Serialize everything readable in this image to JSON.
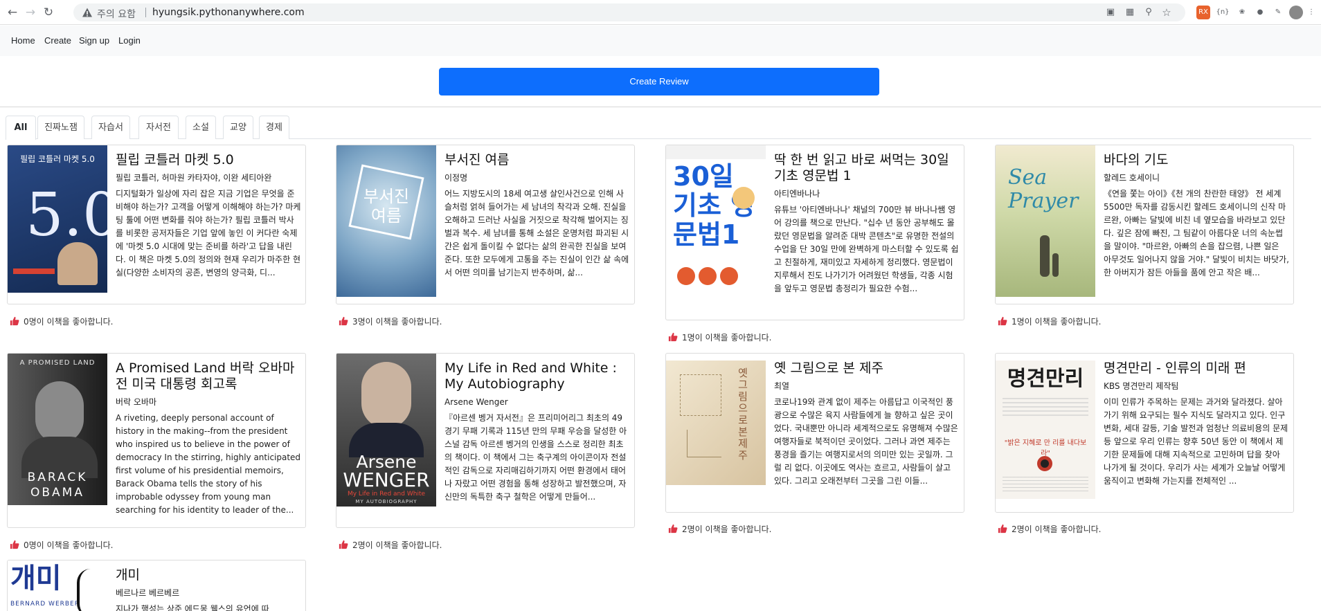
{
  "browser": {
    "warning": "주의 요함",
    "url": "hyungsik.pythonanywhere.com"
  },
  "nav": {
    "links": [
      "Home",
      "Create",
      "Sign up",
      "Login"
    ]
  },
  "create_button": "Create Review",
  "tabs": [
    "All",
    "진짜노잼",
    "자습서",
    "자서전",
    "소설",
    "교양",
    "경제"
  ],
  "books": [
    {
      "title": "필립 코틀러 마켓 5.0",
      "author": "필립 코틀러, 허마원 카타자야, 이완 세티아완",
      "desc": "디지털화가 일상에 자리 잡은 지금 기업은 무엇을 준비해야 하는가? 고객을 어떻게 이해해야 하는가? 마케팅 툴에 어떤 변화를 줘야 하는가? 필립 코틀러 박사를 비롯한 공저자들은 기업 앞에 놓인 이 커다란 숙제에 '마켓 5.0 시대에 맞는 준비를 하라'고 답을 내린다. 이 책은 마켓 5.0의 정의와 현재 우리가 마주한 현실(다양한 소비자의 공존, 변영의 양극화, 디...",
      "likes": "0명이 이책을 좋아합니다.",
      "cover_text": "필립 코틀러 마켓 5.0"
    },
    {
      "title": "부서진 여름",
      "author": "이정명",
      "desc": "어느 지방도시의 18세 여고생 살인사건으로 인해 사슬처럼 얽혀 들어가는 세 남녀의 착각과 오해. 진실을 오해하고 드러난 사실을 거짓으로 착각해 벌어지는 징벌과 복수. 세 남녀를 통해 소설은 운명처럼 파괴된 시간은 쉽게 돌이킬 수 없다는 삶의 완곡한 진실을 보여준다. 또한 모두에게 고통을 주는 진실이 인간 삶 속에서 어떤 의미를 남기는지 반추하며, 삶...",
      "likes": "3명이 이책을 좋아합니다.",
      "cover_text": "부서진 여름"
    },
    {
      "title": "딱 한 번 읽고 바로 써먹는 30일 기초 영문법 1",
      "author": "아티엔바나나",
      "desc": "유튜브 '아티엔바나나' 채널의 700만 뷰 바나나쌤 영어 강의를 책으로 만난다. \"십수 년 동안 공부해도 몰랐던 영문법을 알려준 대박 콘텐츠\"로 유명한 전설의 수업을 단 30일 만에 완벽하게 마스터할 수 있도록 쉽고 친절하게, 재미있고 자세하게 정리했다. 영문법이 지루해서 진도 나가기가 어려웠던 학생들, 각종 시험을 앞두고 영문법 총정리가 필요한 수험...",
      "likes": "1명이 이책을 좋아합니다.",
      "cover_text": "30일 기초 영문법1"
    },
    {
      "title": "바다의 기도",
      "author": "할레드 호세이니",
      "desc": "《연을 쫓는 아이》《천 개의 찬란한 태양》 전 세계 5500만 독자를 감동시킨 할레드 호세이니의 신작 마르완, 아빠는 달빛에 비친 네 옆모습을 바라보고 있단다. 깊은 잠에 빠진, 그 팀같이 아름다운 너의 속눈썹을 말이야. \"마르완, 아빠의 손을 잡으렴, 나쁜 일은 아무것도 일어나지 않을 거야.\" 달빛이 비치는 바닷가, 한 아버지가 잠든 아들을 품에 안고 작은 배...",
      "likes": "1명이 이책을 좋아합니다.",
      "cover_text": "Sea Prayer"
    },
    {
      "title": "A Promised Land 버락 오바마 전 미국 대통령 회고록",
      "author": "버락 오바마",
      "desc": "A riveting, deeply personal account of history in the making--from the president who inspired us to believe in the power of democracy In the stirring, highly anticipated first volume of his presidential memoirs, Barack Obama tells the story of his improbable odyssey from young man searching for his identity to leader of the...",
      "likes": "0명이 이책을 좋아합니다.",
      "cover_top": "A PROMISED LAND",
      "cover_name": "BARACK OBAMA"
    },
    {
      "title": "My Life in Red and White : My Autobiography",
      "author": "Arsene Wenger",
      "desc": "『아르센 벵거 자서전』은 프리미어리그 최초의 49경기 무패 기록과 115년 만의 무패 우승을 달성한 아스널 감독 아르센 벵거의 인생을 스스로 정리한 최초의 책이다. 이 책에서 그는 축구계의 아이콘이자 전설적인 감독으로 자리매김하기까지 어떤 환경에서 태어나 자랐고 어떤 경험을 통해 성장하고 발전했으며, 자신만의 독특한 축구 철학은 어떻게 만들어...",
      "likes": "2명이 이책을 좋아합니다.",
      "cover_name1": "Arsene",
      "cover_name2": "WENGER",
      "cover_sub": "My Life in Red and White",
      "cover_bottom": "MY AUTOBIOGRAPHY"
    },
    {
      "title": "옛 그림으로 본 제주",
      "author": "최열",
      "desc": "코로나19와 관계 없이 제주는 아름답고 이국적인 풍광으로 수많은 육지 사람들에게 늘 향하고 싶은 곳이었다. 국내뿐만 아니라 세계적으로도 유명해져 수많은 여행자들로 북적이던 곳이었다. 그러나 과연 제주는 풍경을 즐기는 여행지로서의 의미만 있는 곳일까. 그럴 리 없다. 이곳에도 역사는 흐르고, 사람들이 살고 있다. 그리고 오래전부터 그곳을 그린 이들...",
      "likes": "2명이 이책을 좋아합니다.",
      "cover_text": "옛 그림으로 본 제주"
    },
    {
      "title": "명견만리 - 인류의 미래 편",
      "author": "KBS 명견만리 제작팀",
      "desc": "이미 인류가 주목하는 문제는 과거와 달라졌다. 살아가기 위해 요구되는 필수 지식도 달라지고 있다. 인구 변화, 세대 갈등, 기술 발전과 엄청난 의료비용의 문제 등 앞으로 우리 인류는 향후 50년 동안 이 책에서 제기한 문제들에 대해 지속적으로 고민하며 답을 찾아 나가게 될 것이다. 우리가 사는 세계가 오늘날 어떻게 움직이고 변화해 가는지를 전체적인 ...",
      "likes": "2명이 이책을 좋아합니다.",
      "cover_text": "명견만리",
      "cover_quote": "\"밝은 지혜로 만 리를 내다보라\""
    },
    {
      "title": "개미",
      "author": "베르나르 베르베르",
      "desc": "지나가 행성는 상준 에드몽 웰스의 유언에 따",
      "likes": "",
      "cover_text": "개미",
      "cover_name": "BERNARD WERBER"
    }
  ]
}
